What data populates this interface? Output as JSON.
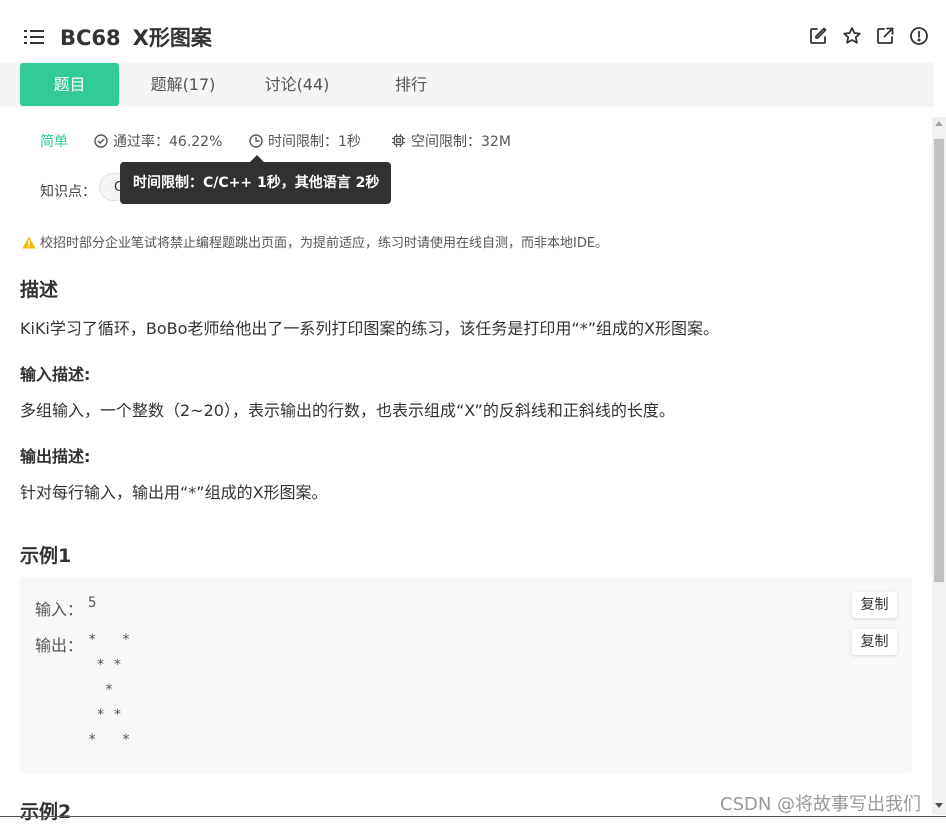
{
  "header": {
    "problem_code": "BC68",
    "problem_title": "X形图案",
    "icons": [
      "menu-icon",
      "edit-icon",
      "star-icon",
      "share-icon",
      "report-icon"
    ]
  },
  "tabs": [
    {
      "label": "题目",
      "active": true
    },
    {
      "label": "题解(17)",
      "active": false
    },
    {
      "label": "讨论(44)",
      "active": false
    },
    {
      "label": "排行",
      "active": false
    }
  ],
  "meta": {
    "difficulty": "简单",
    "pass_rate": "通过率：46.22%",
    "time_limit": "时间限制：1秒",
    "space_limit": "空间限制：32M"
  },
  "knowledge": {
    "label": "知识点：",
    "tag_partial": "C"
  },
  "tooltip": "时间限制：C/C++ 1秒，其他语言 2秒",
  "notice": "校招时部分企业笔试将禁止编程题跳出页面，为提前适应，练习时请使用在线自测，而非本地IDE。",
  "description": {
    "heading": "描述",
    "text": "KiKi学习了循环，BoBo老师给他出了一系列打印图案的练习，该任务是打印用“*”组成的X形图案。"
  },
  "input_desc": {
    "heading": "输入描述:",
    "text": "多组输入，一个整数（2~20），表示输出的行数，也表示组成“X”的反斜线和正斜线的长度。"
  },
  "output_desc": {
    "heading": "输出描述:",
    "text": "针对每行输入，输出用“*”组成的X形图案。"
  },
  "example1": {
    "heading": "示例1",
    "input_label": "输入：",
    "input_value": "5",
    "output_label": "输出：",
    "output_value": "*   *\n * * \n  *  \n * * \n*   *",
    "copy_label": "复制"
  },
  "example2": {
    "heading": "示例2"
  },
  "watermark": "CSDN @将故事写出我们",
  "colors": {
    "accent": "#32ca99",
    "tooltip_bg": "#303133",
    "warning": "#f5b800"
  }
}
